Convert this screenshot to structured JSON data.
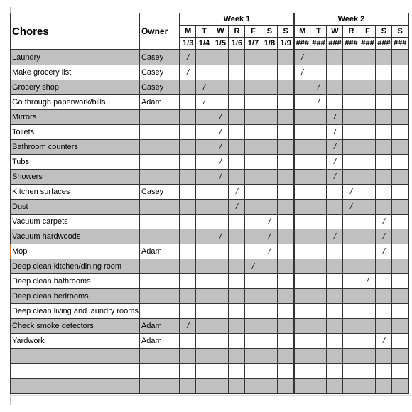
{
  "header": {
    "chores": "Chores",
    "owner": "Owner",
    "weeks": [
      "Week 1",
      "Week 2"
    ]
  },
  "days": [
    "M",
    "T",
    "W",
    "R",
    "F",
    "S",
    "S",
    "M",
    "T",
    "W",
    "R",
    "F",
    "S",
    "S"
  ],
  "dates": [
    "1/3",
    "1/4",
    "1/5",
    "1/6",
    "1/7",
    "1/8",
    "1/9",
    "###",
    "###",
    "###",
    "###",
    "###",
    "###",
    "###"
  ],
  "mark": "/",
  "colors": {
    "shaded_row": "#c0c0c0",
    "grid": "#333333"
  },
  "rows": [
    {
      "chore": "Laundry",
      "owner": "Casey",
      "marks": [
        0,
        7
      ]
    },
    {
      "chore": "Make grocery list",
      "owner": "Casey",
      "marks": [
        0,
        7
      ]
    },
    {
      "chore": "Grocery shop",
      "owner": "Casey",
      "marks": [
        1,
        8
      ]
    },
    {
      "chore": "Go through paperwork/bills",
      "owner": "Adam",
      "marks": [
        1,
        8
      ]
    },
    {
      "chore": "Mirrors",
      "owner": "",
      "marks": [
        2,
        9
      ]
    },
    {
      "chore": "Toilets",
      "owner": "",
      "marks": [
        2,
        9
      ]
    },
    {
      "chore": "Bathroom counters",
      "owner": "",
      "marks": [
        2,
        9
      ]
    },
    {
      "chore": "Tubs",
      "owner": "",
      "marks": [
        2,
        9
      ]
    },
    {
      "chore": "Showers",
      "owner": "",
      "marks": [
        2,
        9
      ]
    },
    {
      "chore": "Kitchen surfaces",
      "owner": "Casey",
      "marks": [
        3,
        10
      ]
    },
    {
      "chore": "Dust",
      "owner": "",
      "marks": [
        3,
        10
      ]
    },
    {
      "chore": "Vacuum carpets",
      "owner": "",
      "marks": [
        5,
        12
      ]
    },
    {
      "chore": "Vacuum hardwoods",
      "owner": "",
      "marks": [
        2,
        5,
        9,
        12
      ]
    },
    {
      "chore": "Mop",
      "owner": "Adam",
      "marks": [
        5,
        12
      ]
    },
    {
      "chore": "Deep clean kitchen/dining room",
      "owner": "",
      "marks": [
        4
      ]
    },
    {
      "chore": "Deep clean bathrooms",
      "owner": "",
      "marks": [
        11
      ]
    },
    {
      "chore": "Deep clean bedrooms",
      "owner": "",
      "marks": []
    },
    {
      "chore": "Deep clean living and laundry rooms",
      "owner": "",
      "marks": []
    },
    {
      "chore": "Check smoke detectors",
      "owner": "Adam",
      "marks": [
        0
      ]
    },
    {
      "chore": "Yardwork",
      "owner": "Adam",
      "marks": [
        12
      ]
    },
    {
      "chore": "",
      "owner": "",
      "marks": []
    },
    {
      "chore": "",
      "owner": "",
      "marks": []
    },
    {
      "chore": "",
      "owner": "",
      "marks": []
    }
  ]
}
